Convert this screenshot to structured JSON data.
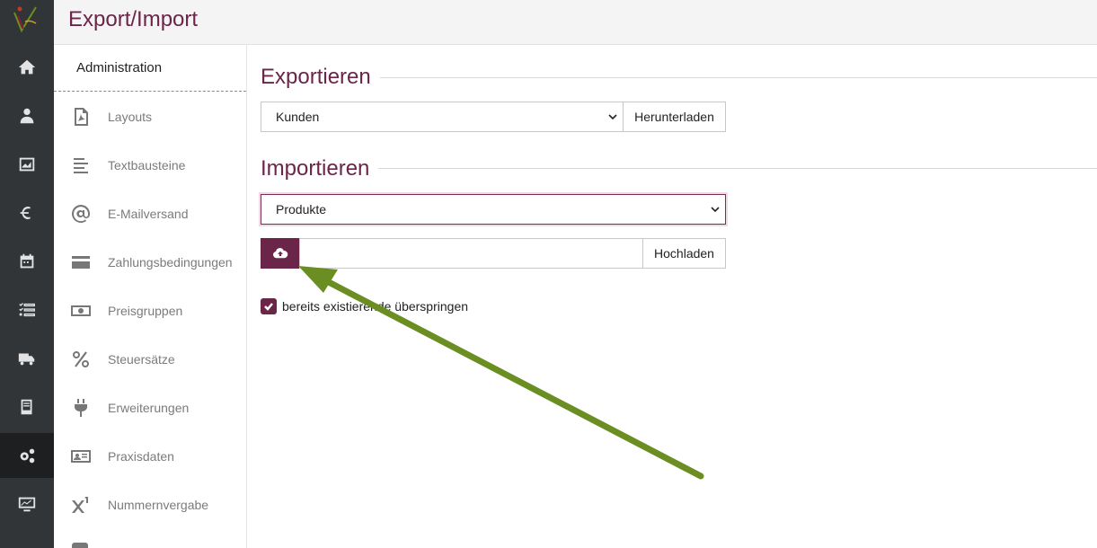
{
  "header": {
    "title": "Export/Import"
  },
  "rail": {
    "items": [
      {
        "icon": "home-icon"
      },
      {
        "icon": "user-doctor-icon"
      },
      {
        "icon": "image-chart-icon"
      },
      {
        "icon": "euro-icon"
      },
      {
        "icon": "calendar-icon"
      },
      {
        "icon": "task-list-icon"
      },
      {
        "icon": "truck-icon"
      },
      {
        "icon": "book-icon"
      },
      {
        "icon": "gears-icon",
        "active": true
      },
      {
        "icon": "chart-screen-icon"
      }
    ]
  },
  "sidebar": {
    "heading": "Administration",
    "items": [
      {
        "label": "Layouts",
        "icon": "pdf-file-icon"
      },
      {
        "label": "Textbausteine",
        "icon": "text-align-icon"
      },
      {
        "label": "E-Mailversand",
        "icon": "at-icon"
      },
      {
        "label": "Zahlungsbedingungen",
        "icon": "credit-card-icon"
      },
      {
        "label": "Preisgruppen",
        "icon": "money-bill-icon"
      },
      {
        "label": "Steuersätze",
        "icon": "percent-icon"
      },
      {
        "label": "Erweiterungen",
        "icon": "plug-icon"
      },
      {
        "label": "Praxisdaten",
        "icon": "id-card-icon"
      },
      {
        "label": "Nummernvergabe",
        "icon": "superscript-icon"
      }
    ]
  },
  "export": {
    "title": "Exportieren",
    "selected": "Kunden",
    "button": "Herunterladen"
  },
  "import": {
    "title": "Importieren",
    "selected": "Produkte",
    "button": "Hochladen",
    "upload_icon": "cloud-upload-icon",
    "skip_label": "bereits existierende überspringen",
    "skip_checked": true
  },
  "colors": {
    "accent": "#6b2548",
    "rail": "#323538",
    "annotation_arrow": "#6b8e23"
  }
}
